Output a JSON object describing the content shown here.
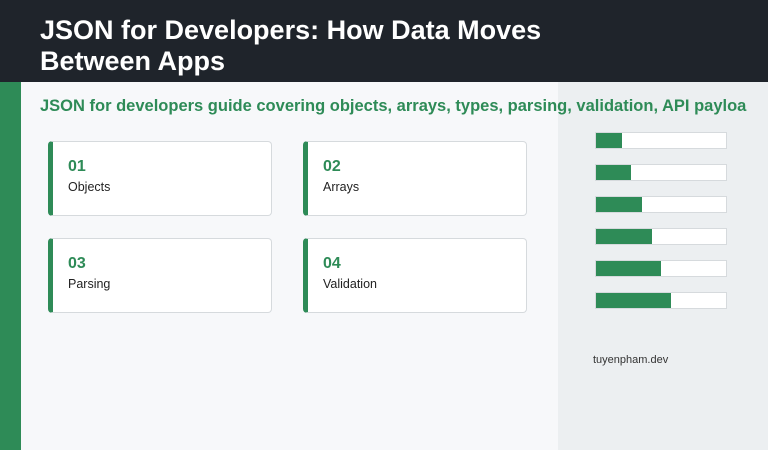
{
  "header": {
    "title": "JSON for Developers: How Data Moves Between Apps"
  },
  "subtitle": "JSON for developers guide covering objects, arrays, types, parsing, validation, API payloa",
  "cards": [
    {
      "number": "01",
      "label": "Objects"
    },
    {
      "number": "02",
      "label": "Arrays"
    },
    {
      "number": "03",
      "label": "Parsing"
    },
    {
      "number": "04",
      "label": "Validation"
    }
  ],
  "bars": [
    {
      "level": 0.2
    },
    {
      "level": 0.27
    },
    {
      "level": 0.35
    },
    {
      "level": 0.43
    },
    {
      "level": 0.5
    },
    {
      "level": 0.58
    }
  ],
  "footer": {
    "domain": "tuyenpham.dev"
  },
  "colors": {
    "header_bg": "#1f242b",
    "accent": "#2e8b57",
    "panel_bg": "#eceff1",
    "page_bg": "#f7f8fa"
  }
}
